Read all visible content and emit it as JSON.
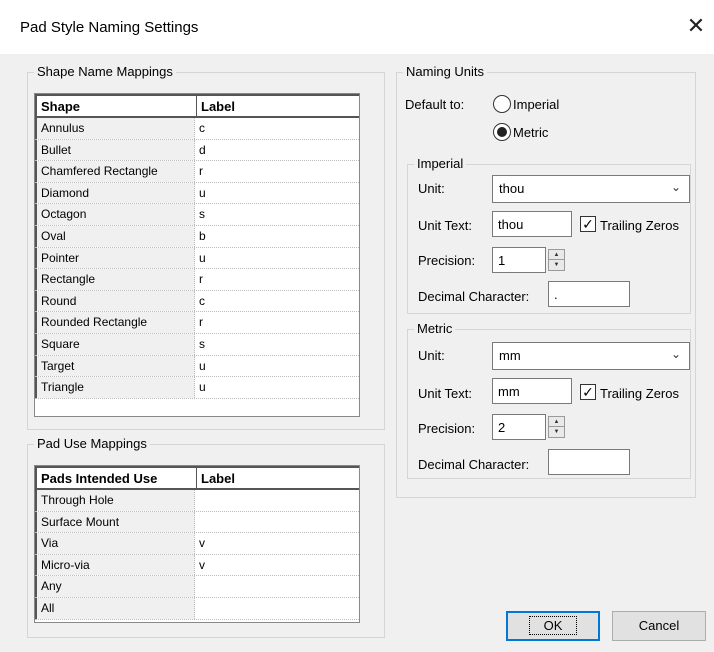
{
  "window": {
    "title": "Pad Style Naming Settings",
    "close_glyph": "✕"
  },
  "shape_group": {
    "title": "Shape Name Mappings",
    "headers": {
      "shape": "Shape",
      "label": "Label"
    },
    "rows": [
      {
        "shape": "Annulus",
        "label": "c"
      },
      {
        "shape": "Bullet",
        "label": "d"
      },
      {
        "shape": "Chamfered Rectangle",
        "label": "r"
      },
      {
        "shape": "Diamond",
        "label": "u"
      },
      {
        "shape": "Octagon",
        "label": "s"
      },
      {
        "shape": "Oval",
        "label": "b"
      },
      {
        "shape": "Pointer",
        "label": "u"
      },
      {
        "shape": "Rectangle",
        "label": "r"
      },
      {
        "shape": "Round",
        "label": "c"
      },
      {
        "shape": "Rounded Rectangle",
        "label": "r"
      },
      {
        "shape": "Square",
        "label": "s"
      },
      {
        "shape": "Target",
        "label": "u"
      },
      {
        "shape": "Triangle",
        "label": "u"
      }
    ]
  },
  "pad_group": {
    "title": "Pad Use Mappings",
    "headers": {
      "use": "Pads Intended Use",
      "label": "Label"
    },
    "rows": [
      {
        "use": "Through Hole",
        "label": ""
      },
      {
        "use": "Surface Mount",
        "label": ""
      },
      {
        "use": "Via",
        "label": "v"
      },
      {
        "use": "Micro-via",
        "label": "v"
      },
      {
        "use": "Any",
        "label": ""
      },
      {
        "use": "All",
        "label": ""
      }
    ]
  },
  "naming_units": {
    "title": "Naming Units",
    "default_to_label": "Default to:",
    "imperial_option": "Imperial",
    "metric_option": "Metric",
    "selected": "Metric",
    "imperial": {
      "title": "Imperial",
      "unit_label": "Unit:",
      "unit_value": "thou",
      "unit_text_label": "Unit Text:",
      "unit_text_value": "thou",
      "trailing_zeros_label": "Trailing Zeros",
      "trailing_zeros_checked": true,
      "precision_label": "Precision:",
      "precision_value": "1",
      "decimal_label": "Decimal Character:",
      "decimal_value": "."
    },
    "metric": {
      "title": "Metric",
      "unit_label": "Unit:",
      "unit_value": "mm",
      "unit_text_label": "Unit Text:",
      "unit_text_value": "mm",
      "trailing_zeros_label": "Trailing Zeros",
      "trailing_zeros_checked": true,
      "precision_label": "Precision:",
      "precision_value": "2",
      "decimal_label": "Decimal Character:",
      "decimal_value": ""
    }
  },
  "buttons": {
    "ok": "OK",
    "cancel": "Cancel"
  },
  "icons": {
    "chevron": "chevron-down-icon",
    "check": "checkmark-icon"
  }
}
